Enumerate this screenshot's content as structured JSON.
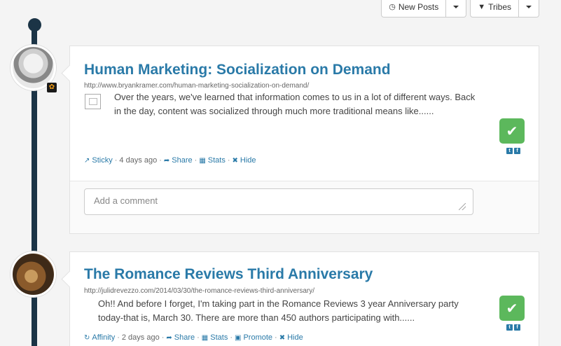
{
  "toolbar": {
    "new_posts_label": "New Posts",
    "tribes_label": "Tribes"
  },
  "posts": [
    {
      "title": "Human Marketing: Socialization on Demand",
      "url": "http://www.bryankramer.com/human-marketing-socialization-on-demand/",
      "excerpt": "Over the years, we've learned that information comes to us in a lot of different ways. Back in the day, content was socialized through much more traditional means like......",
      "actions": {
        "sticky": "Sticky",
        "time": "4 days ago",
        "share": "Share",
        "stats": "Stats",
        "hide": "Hide"
      },
      "comment_placeholder": "Add a comment"
    },
    {
      "title": "The Romance Reviews Third Anniversary",
      "url": "http://julidrevezzo.com/2014/03/30/the-romance-reviews-third-anniversary/",
      "excerpt": "Oh!! And before I forget, I'm taking part in the Romance Reviews 3 year Anniversary party today-that is, March 30. There are more than 450 authors participating with......",
      "actions": {
        "affinity": "Affinity",
        "time": "2 days ago",
        "share": "Share",
        "stats": "Stats",
        "promote": "Promote",
        "hide": "Hide"
      }
    }
  ],
  "icons": {
    "approve": "check-icon",
    "twitter": "twitter-icon",
    "facebook": "facebook-icon",
    "rss": "rss-icon"
  },
  "colors": {
    "title": "#2a7aa8",
    "timeline": "#1b3446",
    "approve": "#5cb85c"
  }
}
